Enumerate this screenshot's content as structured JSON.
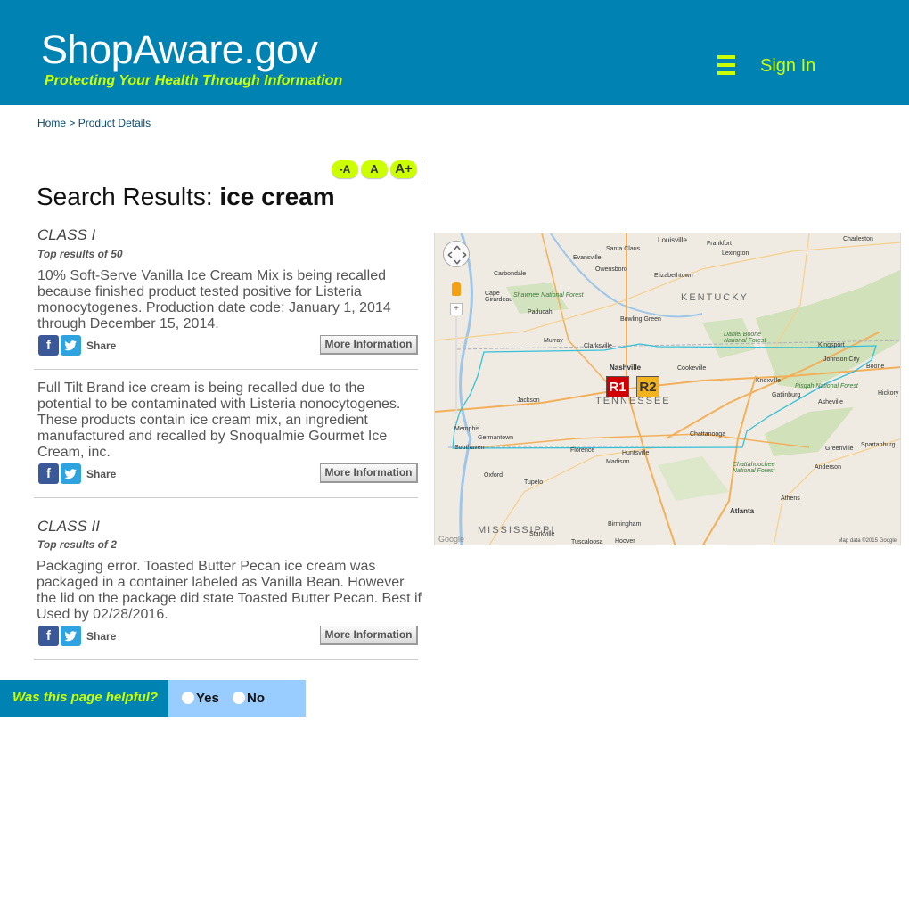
{
  "header": {
    "site_title": "ShopAware.gov",
    "tagline": "Protecting Your Health Through Information",
    "sign_in_label": "Sign In",
    "accent_color": "#ccff00",
    "brand_color": "#0083b3"
  },
  "breadcrumb": {
    "home": "Home",
    "separator": ">",
    "current": "Product Details"
  },
  "font_controls": {
    "decrease": "-A",
    "normal": "A",
    "increase": "A+"
  },
  "search": {
    "label": "Search Results:",
    "query": "ice cream"
  },
  "class_i": {
    "heading": "CLASS I",
    "top_results": "Top results of 50",
    "items": [
      {
        "description": "10% Soft-Serve Vanilla Ice Cream Mix is being recalled because finished product tested positive for Listeria monocytogenes. Production date code: January 1, 2014 through December 15, 2014.",
        "share_label": "Share",
        "more_label": "More Information"
      },
      {
        "description": "Full Tilt Brand ice cream is being recalled due to the potential to be contaminated with Listeria nonocytogenes. These products contain ice cream mix, an ingredient manufactured and recalled by Snoqualmie Gourmet Ice Cream, inc.",
        "share_label": "Share",
        "more_label": "More Information"
      }
    ]
  },
  "class_ii": {
    "heading": "CLASS II",
    "top_results": "Top results of 2",
    "items": [
      {
        "description": "Packaging error. Toasted Butter Pecan ice cream was packaged in a container labeled as Vanilla Bean. However the lid on the package did state Toasted Butter Pecan. Best if Used by 02/28/2016.",
        "share_label": "Share",
        "more_label": "More Information"
      }
    ]
  },
  "map": {
    "markers": [
      "R1",
      "R2"
    ],
    "region_label": "TENNESSEE",
    "state_labels": [
      "KENTUCKY",
      "MISSISSIPPI"
    ],
    "cities": [
      "Louisville",
      "Frankfort",
      "Lexington",
      "Charleston",
      "Evansville",
      "Santa Claus",
      "Owensboro",
      "Elizabethtown",
      "Carbondale",
      "Cape Girardeau",
      "Paducah",
      "Bowling Green",
      "Murray",
      "Clarksville",
      "Nashville",
      "Cookeville",
      "Kingsport",
      "Johnson City",
      "Knoxville",
      "Gatlinburg",
      "Asheville",
      "Hickory",
      "Jackson",
      "Memphis",
      "Germantown",
      "Southaven",
      "Chattanooga",
      "Huntsville",
      "Florence",
      "Madison",
      "Tupelo",
      "Oxford",
      "Greenville",
      "Spartanburg",
      "Anderson",
      "Athens",
      "Atlanta",
      "Birmingham",
      "Starkville",
      "Tuscaloosa",
      "Hoover",
      "Boone"
    ],
    "parks": [
      "Shawnee National Forest",
      "Daniel Boone National Forest",
      "Pisgah National Forest",
      "Chattahoochee National Forest"
    ],
    "attribution": "Map data ©2015 Google",
    "logo": "Google"
  },
  "helpful": {
    "question": "Was this page helpful?",
    "yes": "Yes",
    "no": "No"
  }
}
